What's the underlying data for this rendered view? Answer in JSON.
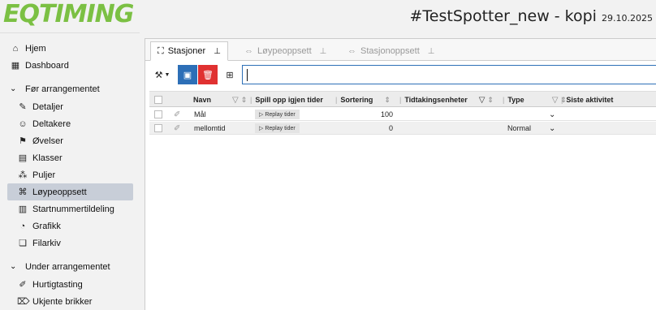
{
  "header": {
    "logo_eq": "EQ",
    "logo_timing": "TIMING",
    "title": "#TestSpotter_new - kopi",
    "date": "29.10.2025"
  },
  "sidebar": {
    "top_items": [
      {
        "label": "Hjem",
        "icon": "home-icon"
      },
      {
        "label": "Dashboard",
        "icon": "dashboard-icon"
      }
    ],
    "section_before": "Før arrangementet",
    "before_items": [
      {
        "label": "Detaljer",
        "icon": "edit-icon"
      },
      {
        "label": "Deltakere",
        "icon": "users-icon"
      },
      {
        "label": "Øvelser",
        "icon": "flag-icon"
      },
      {
        "label": "Klasser",
        "icon": "class-icon"
      },
      {
        "label": "Puljer",
        "icon": "group-icon"
      },
      {
        "label": "Løypeoppsett",
        "icon": "course-icon"
      },
      {
        "label": "Startnummertildeling",
        "icon": "number-icon"
      },
      {
        "label": "Grafikk",
        "icon": "graphics-icon"
      },
      {
        "label": "Filarkiv",
        "icon": "files-icon"
      }
    ],
    "active_item": "Løypeoppsett",
    "section_during": "Under arrangementet",
    "during_items": [
      {
        "label": "Hurtigtasting",
        "icon": "quick-entry-icon"
      },
      {
        "label": "Ukjente brikker",
        "icon": "tag-icon"
      }
    ]
  },
  "tabs": [
    {
      "label": "Stasjoner",
      "active": true
    },
    {
      "label": "Løypeoppsett",
      "active": false
    },
    {
      "label": "Stasjonoppsett",
      "active": false
    }
  ],
  "search": {
    "value": "",
    "placeholder": ""
  },
  "table": {
    "columns": [
      "Navn",
      "Spill opp igjen tider",
      "Sortering",
      "Tidtakingsenheter",
      "Type",
      "Siste aktivitet"
    ],
    "rows": [
      {
        "navn": "Mål",
        "replay": "Replay tider",
        "sortering": "100",
        "type": ""
      },
      {
        "navn": "mellomtid",
        "replay": "Replay tider",
        "sortering": "0",
        "type": "Normal"
      }
    ]
  },
  "colors": {
    "logo": "#7bc043",
    "save": "#2d6fb7",
    "delete": "#e03131",
    "active_nav": "#c8ced8"
  }
}
